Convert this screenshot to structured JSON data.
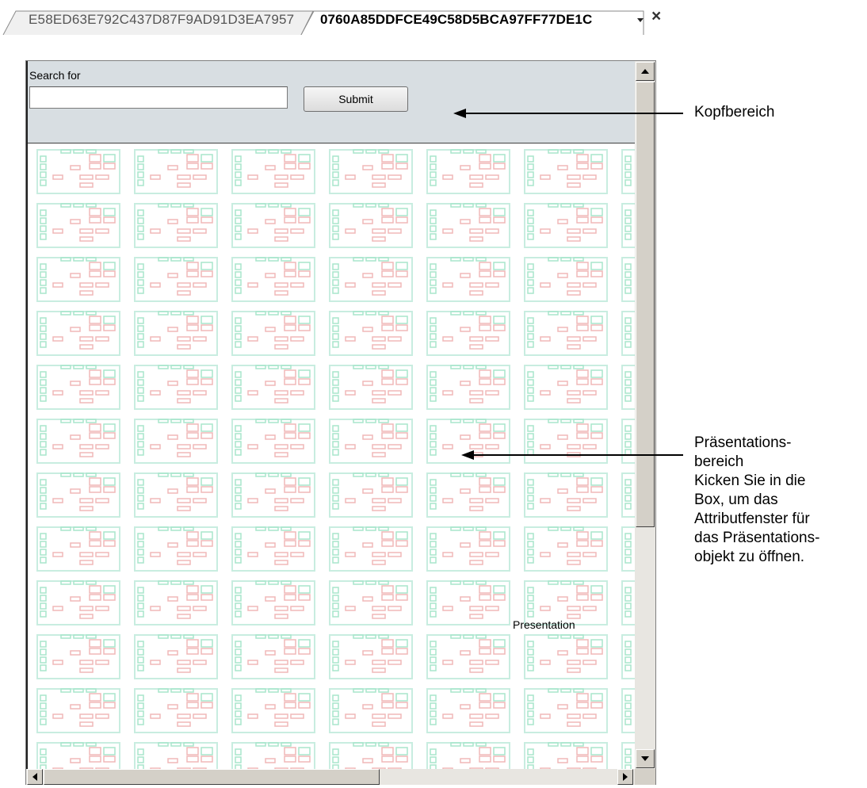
{
  "tabs": [
    {
      "label": "E58ED63E792C437D87F9AD91D3EA7957",
      "active": false
    },
    {
      "label": "0760A85DDFCE49C58D5BCA97FF77DE1C",
      "active": true
    }
  ],
  "tab_controls": {
    "dropdown_icon": "chevron-down-icon",
    "close_icon": "close-icon",
    "close_glyph": "×"
  },
  "header": {
    "search_label": "Search for",
    "search_value": "",
    "search_placeholder": "",
    "submit_label": "Submit"
  },
  "presentation": {
    "label": "Presentation"
  },
  "colors": {
    "header_bg": "#d8dee2",
    "thumbnail_green": "#b7ead2",
    "thumbnail_red": "#f3c1c1"
  },
  "callouts": {
    "kopfbereich": "Kopfbereich",
    "praesentation_lines": [
      "Präsentations-",
      "bereich",
      "Kicken Sie in die",
      "Box, um das",
      "Attributfenster für",
      "das Präsentations-",
      "objekt zu öffnen."
    ]
  }
}
